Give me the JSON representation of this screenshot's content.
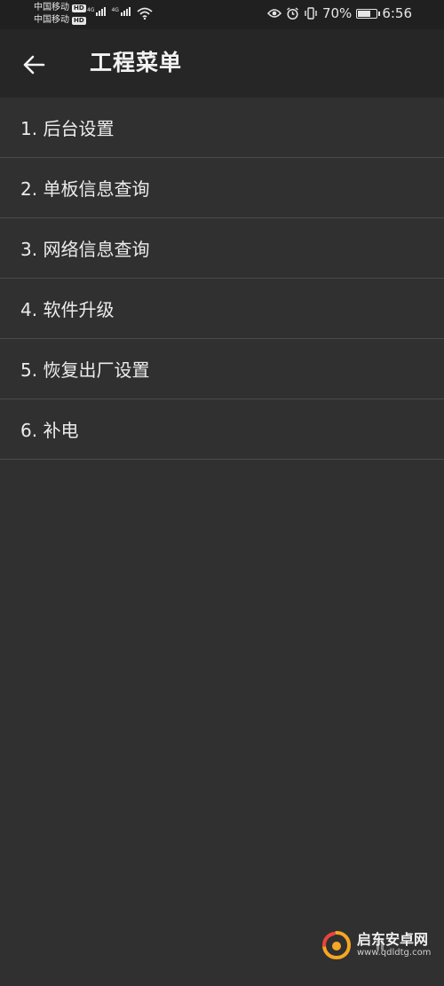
{
  "status_bar": {
    "carrier_1": "中国移动",
    "carrier_2": "中国移动",
    "hd_badge": "HD",
    "network_label": "4G",
    "battery_percent": "70%",
    "battery_level": 0.7,
    "time": "6:56"
  },
  "app_bar": {
    "title": "工程菜单"
  },
  "menu": {
    "items": [
      {
        "label": "1. 后台设置"
      },
      {
        "label": "2. 单板信息查询"
      },
      {
        "label": "3. 网络信息查询"
      },
      {
        "label": "4. 软件升级"
      },
      {
        "label": "5. 恢复出厂设置"
      },
      {
        "label": "6. 补电"
      }
    ]
  },
  "watermark": {
    "name": "启东安卓网",
    "url": "www.qdldtg.com",
    "colors": {
      "logo": "#f5a623",
      "logo_accent": "#e8453c"
    }
  },
  "colors": {
    "background": "#303030",
    "app_bar": "#262626",
    "status_bar": "#202020",
    "divider": "#4a4a4a",
    "text": "#ececec"
  }
}
